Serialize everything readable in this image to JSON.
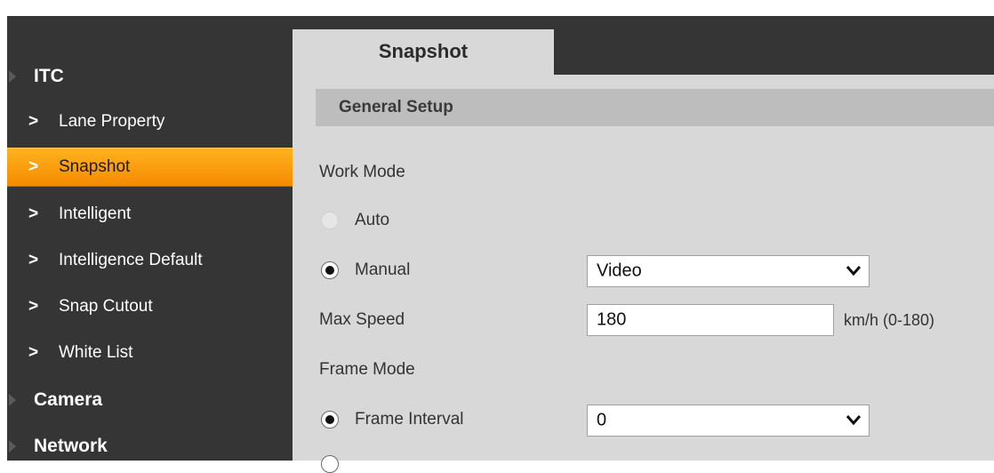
{
  "sidebar": {
    "groups": [
      {
        "label": "ITC"
      },
      {
        "label": "Camera"
      },
      {
        "label": "Network"
      }
    ],
    "items": [
      {
        "chevron": ">",
        "label": "Lane Property"
      },
      {
        "chevron": ">",
        "label": "Snapshot"
      },
      {
        "chevron": ">",
        "label": "Intelligent"
      },
      {
        "chevron": ">",
        "label": "Intelligence Default"
      },
      {
        "chevron": ">",
        "label": "Snap Cutout"
      },
      {
        "chevron": ">",
        "label": "White List"
      }
    ],
    "active_item": "Snapshot",
    "active_color": "#f7941d"
  },
  "tab": {
    "label": "Snapshot"
  },
  "section": {
    "title": "General Setup"
  },
  "form": {
    "work_mode_label": "Work Mode",
    "auto_label": "Auto",
    "auto_state": "disabled",
    "manual_label": "Manual",
    "manual_state": "checked",
    "manual_select_value": "Video",
    "max_speed_label": "Max Speed",
    "max_speed_value": "180",
    "max_speed_unit": "km/h (0-180)",
    "frame_mode_label": "Frame Mode",
    "frame_interval_label": "Frame Interval",
    "frame_interval_state": "checked",
    "frame_interval_value": "0"
  },
  "colors": {
    "sidebar_bg": "#353535",
    "content_bg": "#d8d8d8",
    "section_header_bg": "#bdbdbd"
  }
}
